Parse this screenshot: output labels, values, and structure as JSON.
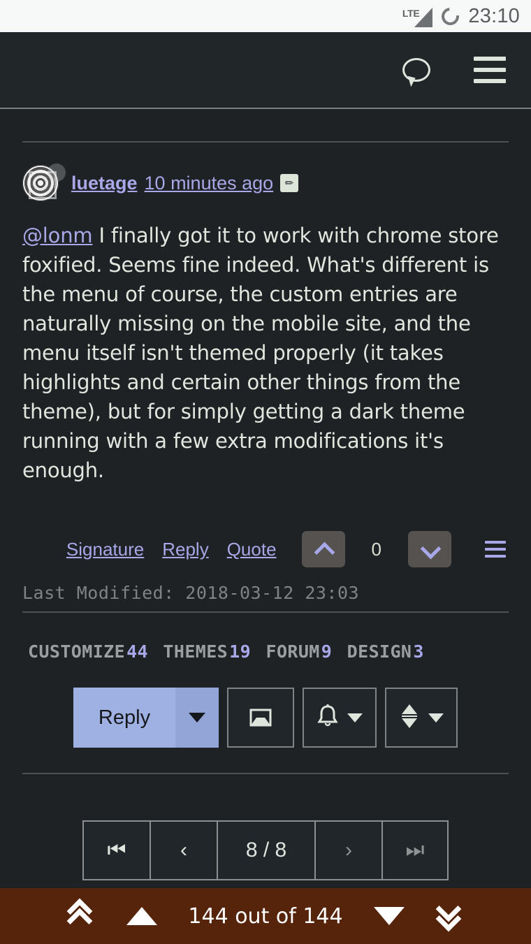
{
  "status_bar": {
    "network_label": "LTE",
    "clock": "23:10",
    "icons": [
      "signal-icon",
      "sync-spinner-icon"
    ]
  },
  "topbar": {
    "chat_icon": "speech-bubble-icon",
    "menu_icon": "hamburger-menu-icon"
  },
  "post": {
    "author": "luetage",
    "timestamp": "10 minutes ago",
    "edit_icon": "✏",
    "avatar_alt": "luetage avatar",
    "mention": "@lonm",
    "body": " I finally got it to work with chrome store foxified. Seems fine indeed. What's different is the menu of course, the custom entries are naturally missing on the mobile site, and the menu itself isn't themed properly (it takes highlights and certain other things from the theme), but for simply getting a dark theme running with a few extra modifications it's enough.",
    "last_modified": "Last Modified: 2018-03-12 23:03",
    "actions": {
      "signature": "Signature",
      "reply": "Reply",
      "quote": "Quote",
      "vote_count": "0",
      "upvote_icon": "chevron-up-icon",
      "downvote_icon": "chevron-down-icon",
      "more_icon": "post-menu-icon"
    }
  },
  "tags": [
    {
      "name": "CUSTOMIZE",
      "count": "44"
    },
    {
      "name": "THEMES",
      "count": "19"
    },
    {
      "name": "FORUM",
      "count": "9"
    },
    {
      "name": "DESIGN",
      "count": "3"
    }
  ],
  "reply_toolbar": {
    "reply_label": "Reply",
    "reply_caret_icon": "caret-down-icon",
    "inbox_icon": "inbox-tray-icon",
    "bell_icon": "bell-notification-icon",
    "bell_caret_icon": "caret-down-icon",
    "sort_icon": "sort-updown-icon",
    "sort_caret_icon": "caret-down-icon"
  },
  "pagination": {
    "first_label": "⏮",
    "prev_label": "‹",
    "position": "8 / 8",
    "next_label": "›",
    "last_label": "⏭"
  },
  "bottom_bar": {
    "jump_top_icon": "double-chevron-up-icon",
    "prev_icon": "triangle-up-icon",
    "label": "144 out of 144",
    "next_icon": "triangle-down-icon",
    "jump_bottom_icon": "double-chevron-down-icon"
  },
  "colors": {
    "page_bg": "#1e2224",
    "topbar_bg": "#212629",
    "link": "#a8a7e8",
    "text": "#dfe7de",
    "accent_button": "#9fb1e2",
    "bottom_bar": "#56230b",
    "status_bar_bg": "#f7f8f8"
  }
}
